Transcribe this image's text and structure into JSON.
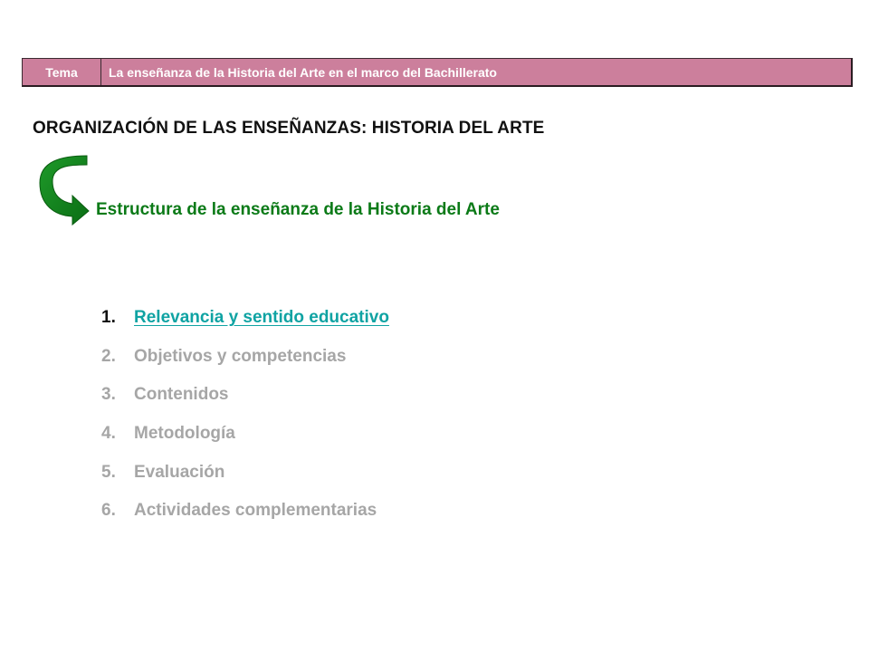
{
  "topic_bar": {
    "label": "Tema",
    "value": "La enseñanza de la Historia del Arte en el marco del Bachillerato"
  },
  "section_heading": "ORGANIZACIÓN DE LAS ENSEÑANZAS: HISTORIA DEL ARTE",
  "subheading": "Estructura de la enseñanza de la Historia del Arte",
  "arrow_icon": "curved-return-arrow-icon",
  "colors": {
    "topic_bar": "#cc7f9c",
    "subheading": "#0b7a17",
    "active_link": "#0fa3a3",
    "inactive_item": "#a6a6a6"
  },
  "menu": {
    "items": [
      {
        "number": "1.",
        "label": "Relevancia y sentido educativo"
      },
      {
        "number": "2.",
        "label": "Objetivos y competencias"
      },
      {
        "number": "3.",
        "label": "Contenidos"
      },
      {
        "number": "4.",
        "label": "Metodología"
      },
      {
        "number": "5.",
        "label": "Evaluación"
      },
      {
        "number": "6.",
        "label": "Actividades complementarias"
      }
    ]
  }
}
